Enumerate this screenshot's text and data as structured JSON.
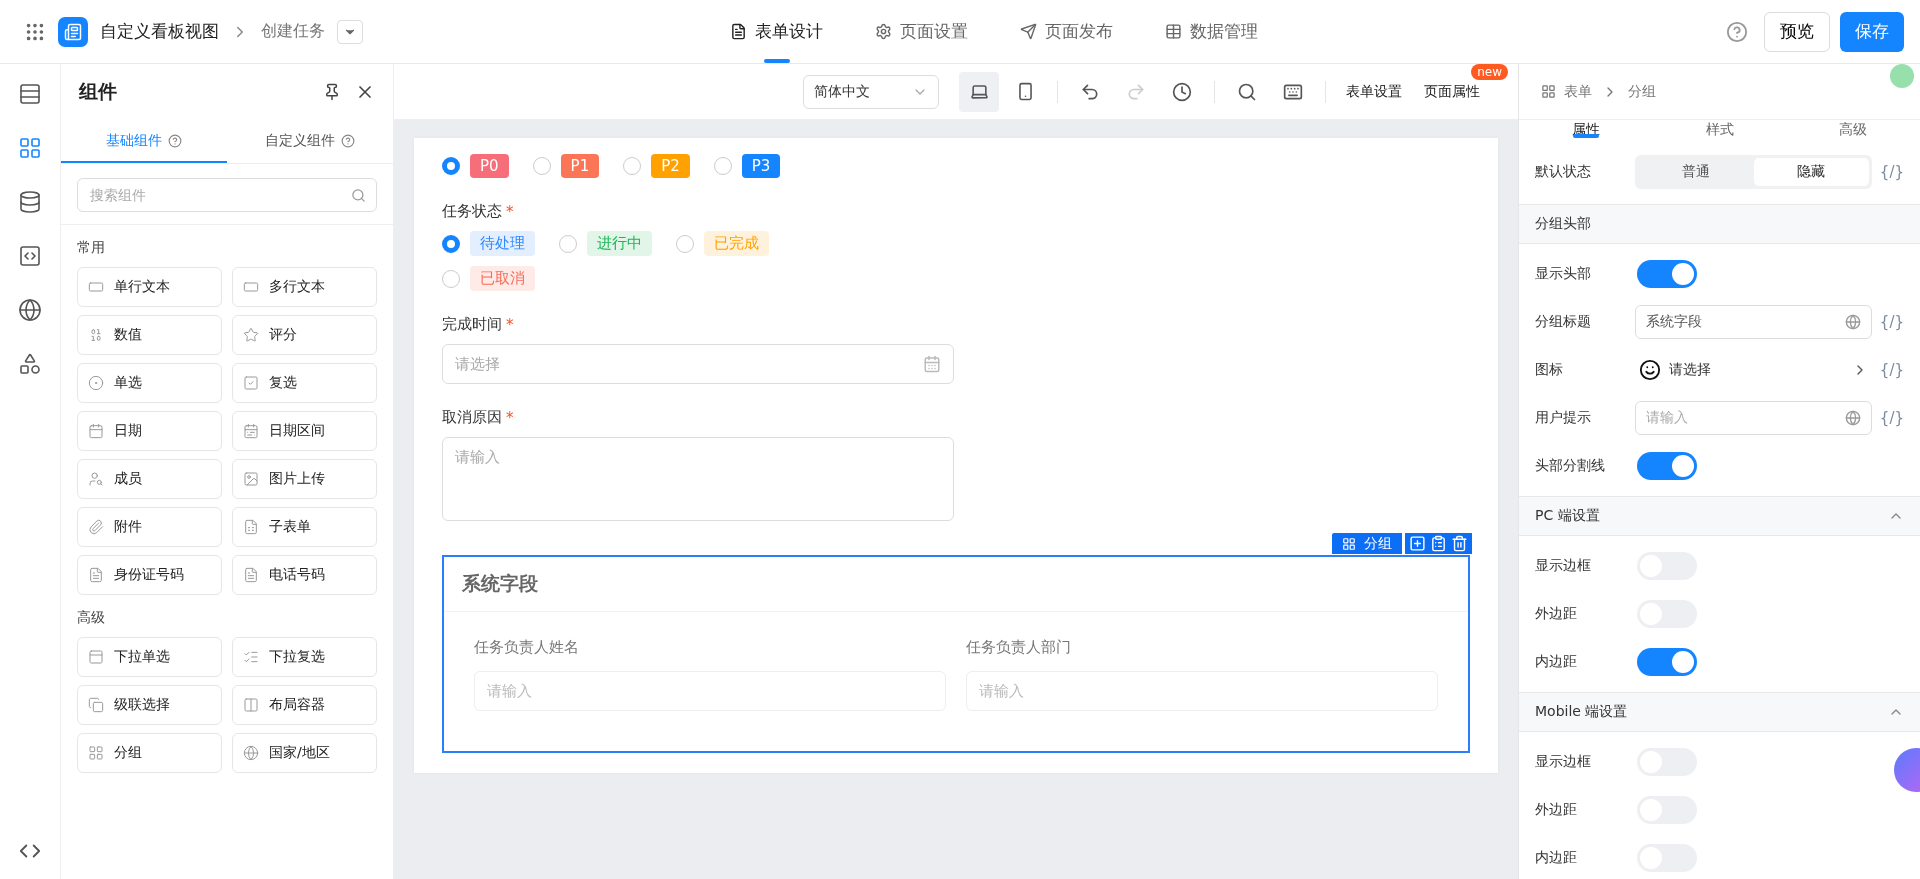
{
  "header": {
    "app_title": "自定义看板视图",
    "page": "创建任务",
    "tabs": [
      {
        "label": "表单设计",
        "selected": true
      },
      {
        "label": "页面设置",
        "selected": false
      },
      {
        "label": "页面发布",
        "selected": false
      },
      {
        "label": "数据管理",
        "selected": false
      }
    ],
    "preview": "预览",
    "save": "保存"
  },
  "rail": [
    {
      "selected": false
    },
    {
      "selected": true
    },
    {
      "selected": false
    },
    {
      "selected": false
    },
    {
      "selected": false
    },
    {
      "selected": false
    }
  ],
  "components_panel": {
    "title": "组件",
    "tabs": [
      {
        "label": "基础组件",
        "selected": true
      },
      {
        "label": "自定义组件",
        "selected": false
      }
    ],
    "search": {
      "placeholder": "搜索组件"
    },
    "groups": [
      {
        "title": "常用",
        "items": [
          "单行文本",
          "多行文本",
          "数值",
          "评分",
          "单选",
          "复选",
          "日期",
          "日期区间",
          "成员",
          "图片上传",
          "附件",
          "子表单",
          "身份证号码",
          "电话号码"
        ]
      },
      {
        "title": "高级",
        "items": [
          "下拉单选",
          "下拉复选",
          "级联选择",
          "布局容器",
          "分组",
          "国家/地区"
        ]
      }
    ]
  },
  "toolbar": {
    "language": "简体中文",
    "devices": [
      {
        "selected": true
      },
      {
        "selected": false
      }
    ],
    "history": [
      {
        "disabled": false
      },
      {
        "disabled": true
      },
      {
        "disabled": false
      }
    ],
    "links": [
      "表单设置",
      "页面属性"
    ],
    "badge": "new"
  },
  "form": {
    "fields": [
      {
        "kind": "priority",
        "options": [
          {
            "label": "P0",
            "selected": true,
            "color": "#f76e7b"
          },
          {
            "label": "P1",
            "selected": false,
            "color": "#fa7656"
          },
          {
            "label": "P2",
            "selected": false,
            "color": "#ffa100"
          },
          {
            "label": "P3",
            "selected": false,
            "color": "#1585ff"
          }
        ]
      },
      {
        "kind": "status",
        "label": "任务状态",
        "mark": "*",
        "options": [
          {
            "label": "待处理",
            "selected": true,
            "color": "#2f88ff"
          },
          {
            "label": "进行中",
            "selected": false,
            "color": "#1fb555"
          },
          {
            "label": "已完成",
            "selected": false,
            "color": "#ffa100"
          },
          {
            "label": "已取消",
            "selected": false,
            "color": "#f76a56"
          }
        ]
      },
      {
        "kind": "date",
        "label": "完成时间",
        "mark": "*",
        "placeholder": "请选择"
      },
      {
        "kind": "textarea",
        "label": "取消原因",
        "mark": "*",
        "placeholder": "请输入"
      },
      {
        "kind": "group",
        "selected": true,
        "tag": "分组",
        "title": "系统字段",
        "fields": [
          {
            "label": "任务负责人姓名",
            "placeholder": "请输入"
          },
          {
            "label": "任务负责人部门",
            "placeholder": "请输入"
          }
        ]
      }
    ]
  },
  "props_panel": {
    "breadcrumb": [
      "表单",
      "分组"
    ],
    "tabs": [
      {
        "label": "属性",
        "selected": true
      },
      {
        "label": "样式",
        "selected": false
      },
      {
        "label": "高级",
        "selected": false
      }
    ],
    "sections": [
      {
        "rows": [
          {
            "kind": "segmented",
            "label": "默认状态",
            "options": [
              {
                "label": "普通",
                "selected": false
              },
              {
                "label": "隐藏",
                "selected": true
              }
            ],
            "expr": "{/}"
          }
        ]
      },
      {
        "title": "分组头部",
        "rows": [
          {
            "kind": "switch",
            "label": "显示头部",
            "on": true
          },
          {
            "kind": "input",
            "label": "分组标题",
            "value": "系统字段",
            "expr": "{/}"
          },
          {
            "kind": "picker",
            "label": "图标",
            "value": "请选择",
            "expr": "{/}"
          },
          {
            "kind": "input",
            "label": "用户提示",
            "placeholder": "请输入",
            "expr": "{/}"
          },
          {
            "kind": "switch",
            "label": "头部分割线",
            "on": true
          }
        ]
      },
      {
        "title": "PC 端设置",
        "expanded": true,
        "rows": [
          {
            "kind": "switch",
            "label": "显示边框",
            "on": false
          },
          {
            "kind": "switch",
            "label": "外边距",
            "on": false
          },
          {
            "kind": "switch",
            "label": "内边距",
            "on": true
          }
        ]
      },
      {
        "title": "Mobile 端设置",
        "expanded": true,
        "rows": [
          {
            "kind": "switch",
            "label": "显示边框",
            "on": false
          },
          {
            "kind": "switch",
            "label": "外边距",
            "on": false
          },
          {
            "kind": "switch",
            "label": "内边距",
            "on": false
          }
        ]
      }
    ]
  }
}
